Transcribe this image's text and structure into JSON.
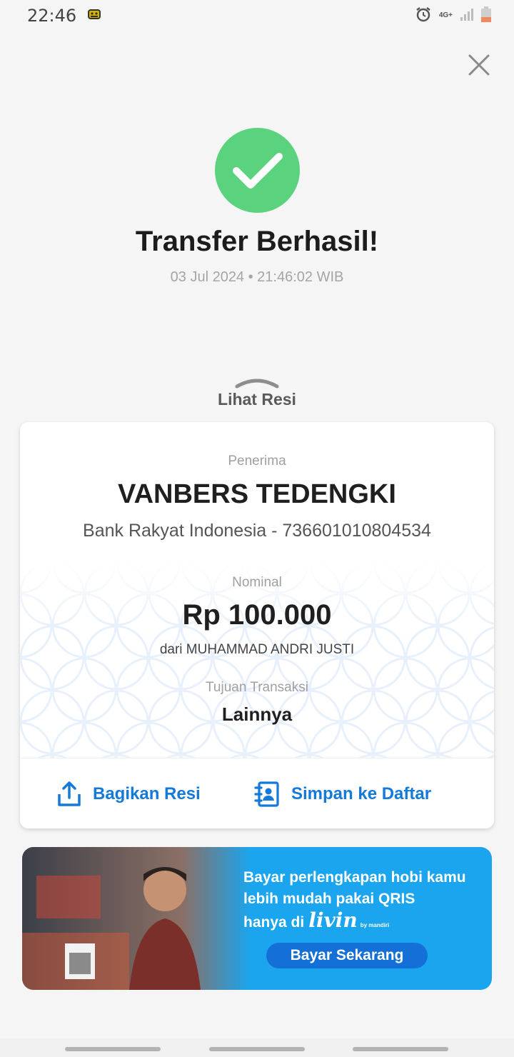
{
  "status_bar": {
    "time": "22:46",
    "network": "4G+",
    "icons": [
      "alarm-icon",
      "signal-icon",
      "battery-icon"
    ]
  },
  "header": {
    "close_icon": "close-icon"
  },
  "success": {
    "icon": "check-icon",
    "color": "#5bd27e",
    "title": "Transfer Berhasil!",
    "datetime": "03 Jul 2024 • 21:46:02 WIB"
  },
  "receipt_toggle": {
    "label": "Lihat Resi",
    "icon": "chevron-up-icon"
  },
  "receipt": {
    "recipient_label": "Penerima",
    "recipient_name": "VANBERS TEDENGKI",
    "recipient_bank": "Bank Rakyat Indonesia - 736601010804534",
    "amount_label": "Nominal",
    "amount": "Rp 100.000",
    "from": "dari MUHAMMAD ANDRI JUSTI",
    "purpose_label": "Tujuan Transaksi",
    "purpose": "Lainnya"
  },
  "actions": {
    "share_label": "Bagikan Resi",
    "save_label": "Simpan ke Daftar",
    "accent": "#1379db"
  },
  "banner": {
    "line1": "Bayar perlengkapan hobi kamu",
    "line2": "lebih mudah pakai QRIS",
    "line3": "hanya di",
    "brand": "livin",
    "brand_sub": "by mandiri",
    "cta": "Bayar Sekarang",
    "background": "#1aa5ee"
  }
}
